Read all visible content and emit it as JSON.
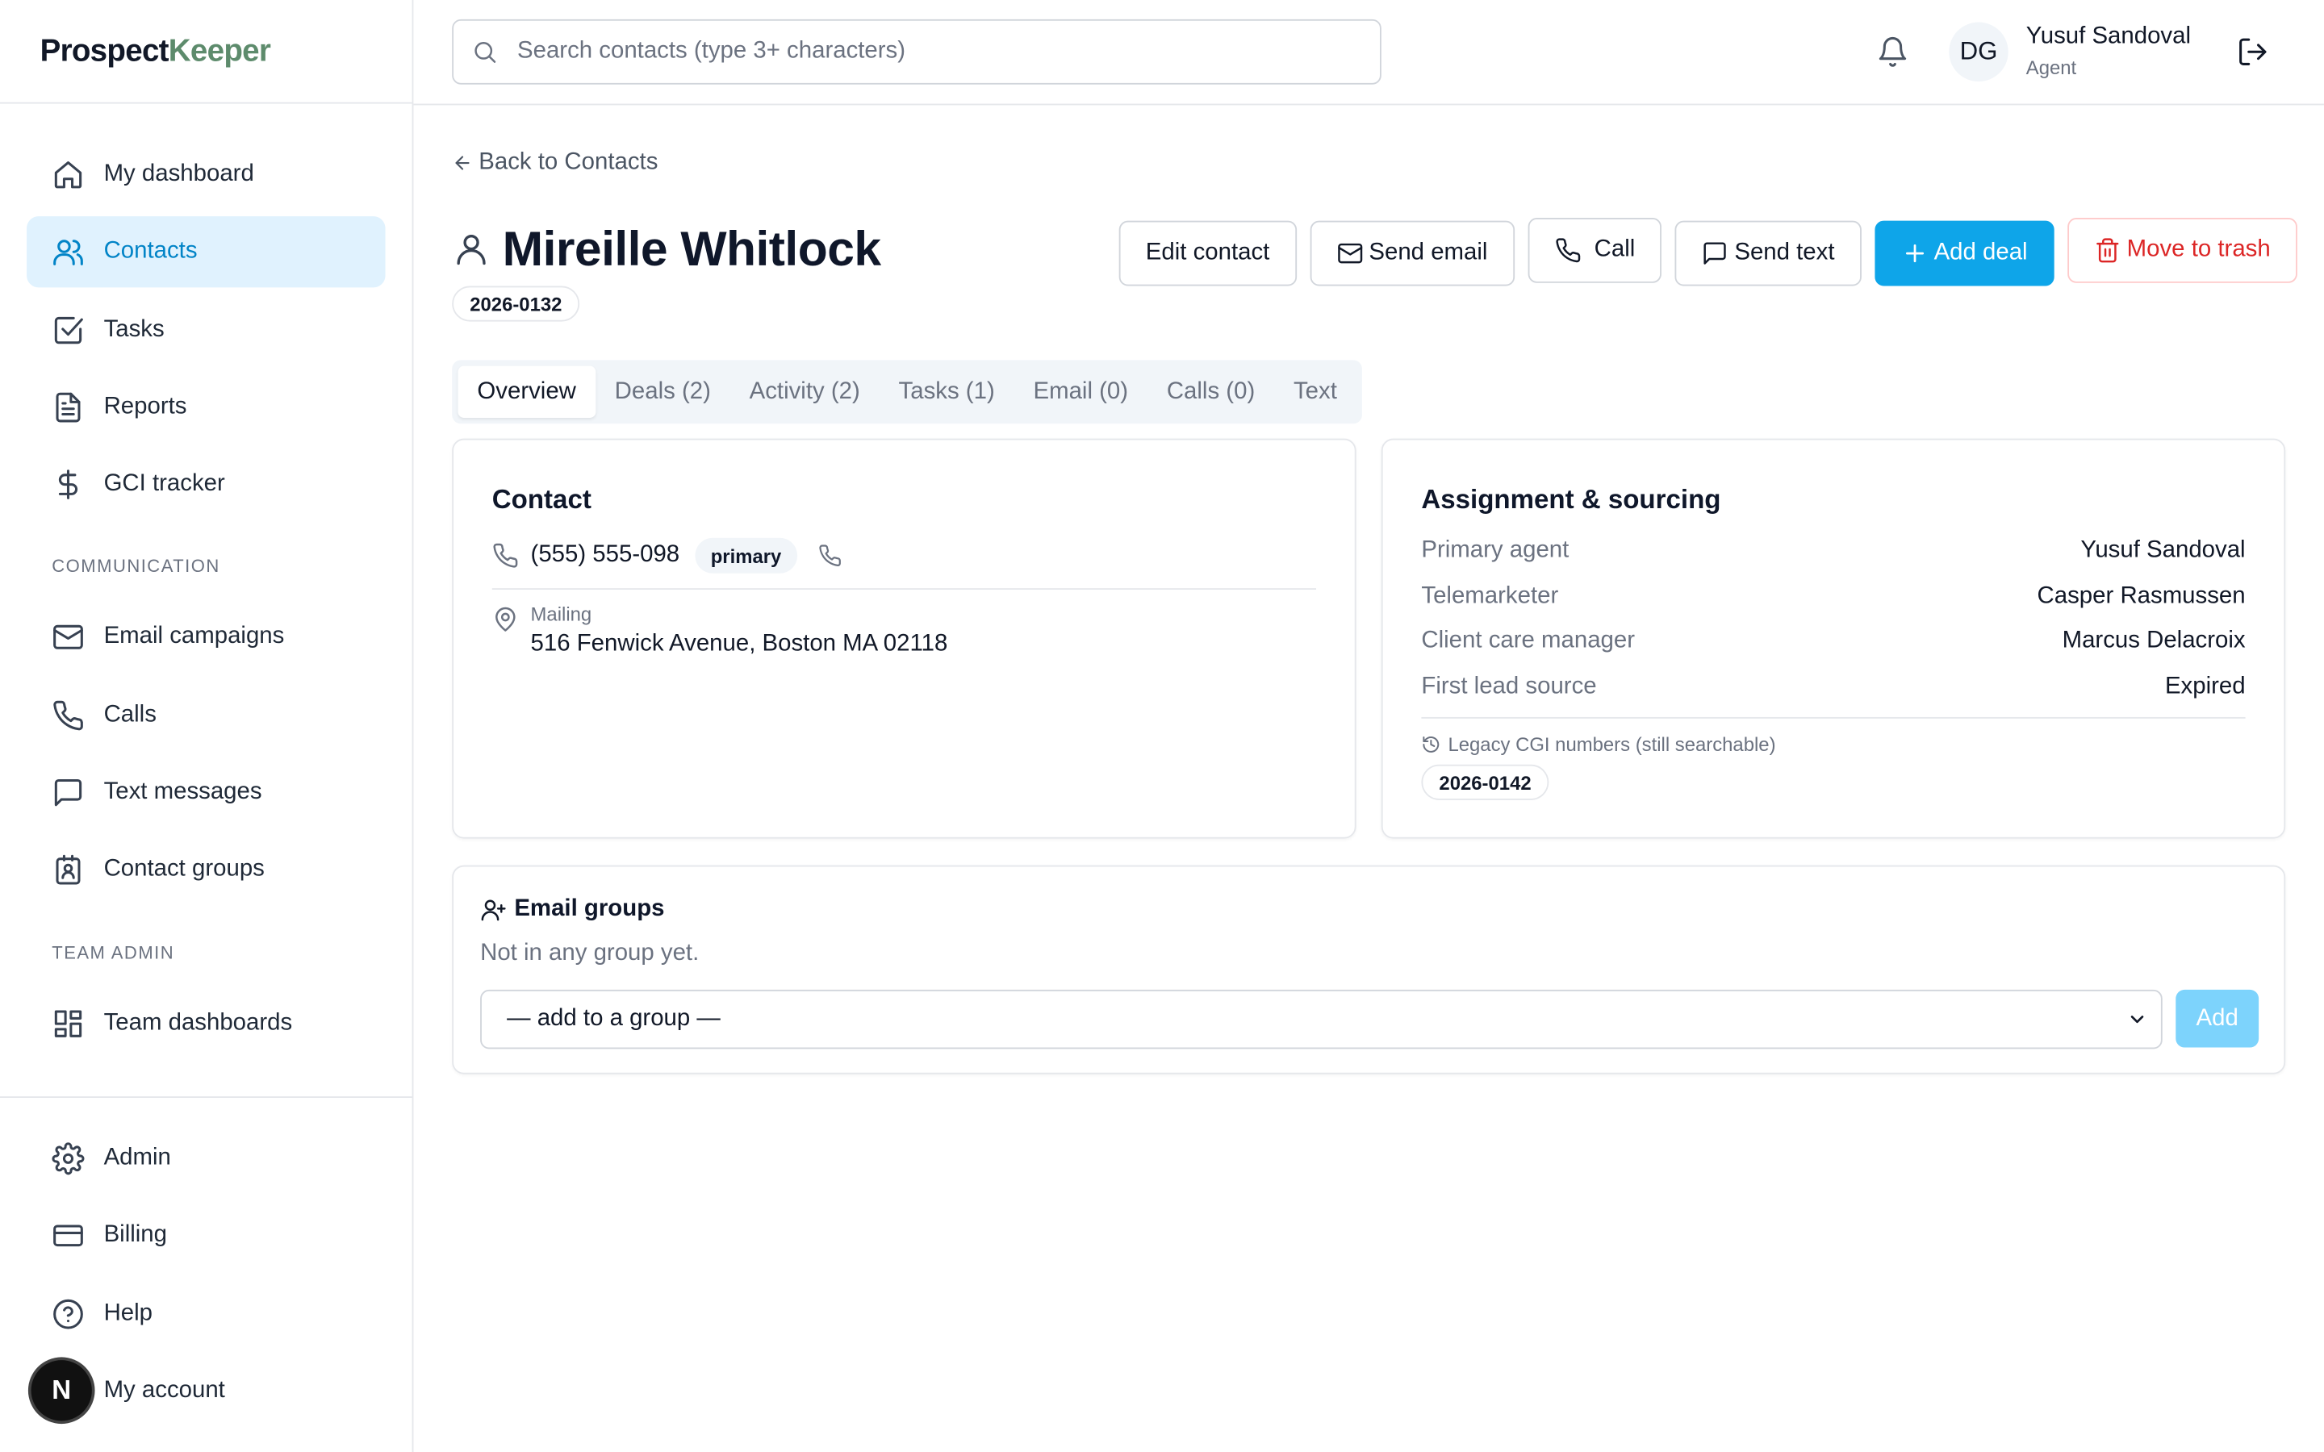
{
  "brand": {
    "part1": "Prospect",
    "part2": "Keeper",
    "accent": "#5d8b6c"
  },
  "sidebar": {
    "items": [
      {
        "label": "My dashboard",
        "icon": "home-icon"
      },
      {
        "label": "Contacts",
        "icon": "users-icon",
        "active": true
      },
      {
        "label": "Tasks",
        "icon": "check-square-icon"
      },
      {
        "label": "Reports",
        "icon": "file-text-icon"
      },
      {
        "label": "GCI tracker",
        "icon": "dollar-icon"
      }
    ],
    "section_communication": "COMMUNICATION",
    "communication": [
      {
        "label": "Email campaigns",
        "icon": "mail-icon"
      },
      {
        "label": "Calls",
        "icon": "phone-icon"
      },
      {
        "label": "Text messages",
        "icon": "message-icon"
      },
      {
        "label": "Contact groups",
        "icon": "contact-card-icon"
      }
    ],
    "section_team": "TEAM ADMIN",
    "team": [
      {
        "label": "Team dashboards",
        "icon": "grid-icon"
      }
    ],
    "bottom": [
      {
        "label": "Admin",
        "icon": "gear-icon"
      },
      {
        "label": "Billing",
        "icon": "credit-card-icon"
      },
      {
        "label": "Help",
        "icon": "help-circle-icon"
      },
      {
        "label": "My account",
        "icon": "user-icon"
      }
    ],
    "badge": "N"
  },
  "header": {
    "search_placeholder": "Search contacts (type 3+ characters)",
    "avatar_initials": "DG",
    "user_name": "Yusuf Sandoval",
    "user_role": "Agent"
  },
  "main": {
    "back_label": "Back to Contacts",
    "contact_name": "Mireille Whitlock",
    "contact_id": "2026-0132",
    "actions": {
      "edit": "Edit contact",
      "email": "Send email",
      "call": "Call",
      "text": "Send text",
      "add_deal": "Add deal",
      "trash": "Move to trash"
    },
    "tabs": [
      "Overview",
      "Deals (2)",
      "Activity (2)",
      "Tasks (1)",
      "Email (0)",
      "Calls (0)",
      "Text"
    ],
    "contact_card": {
      "title": "Contact",
      "phone": "(555) 555-098",
      "phone_tag": "primary",
      "address_label": "Mailing",
      "address": "516 Fenwick Avenue, Boston MA 02118"
    },
    "assignment_card": {
      "title": "Assignment & sourcing",
      "rows": [
        {
          "key": "Primary agent",
          "value": "Yusuf Sandoval"
        },
        {
          "key": "Telemarketer",
          "value": "Casper Rasmussen"
        },
        {
          "key": "Client care manager",
          "value": "Marcus Delacroix"
        },
        {
          "key": "First lead source",
          "value": "Expired"
        }
      ],
      "legacy_label": "Legacy CGI numbers (still searchable)",
      "legacy_number": "2026-0142"
    },
    "groups_card": {
      "title": "Email groups",
      "empty_text": "Not in any group yet.",
      "select_value": "— add to a group —",
      "add_label": "Add"
    }
  },
  "colors": {
    "primary": "#0ea5e9",
    "active_bg": "#e0f2fe",
    "danger": "#dc2626"
  }
}
